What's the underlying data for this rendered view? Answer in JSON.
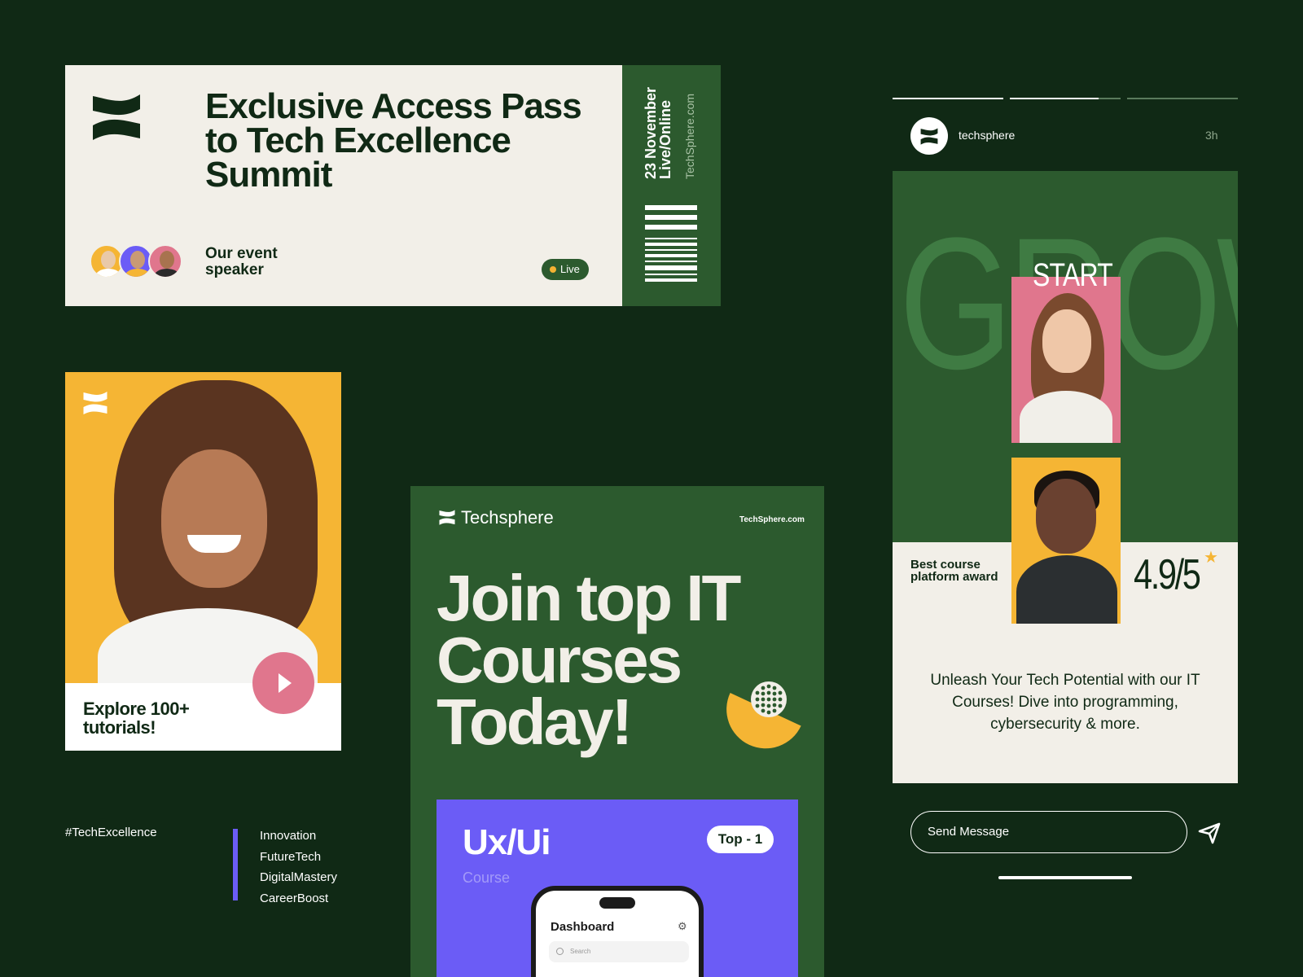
{
  "ticket": {
    "title": "Exclusive Access Pass to Tech Excellence Summit",
    "speaker_label": "Our event speaker",
    "live_label": "Live",
    "stub_date": "23 November",
    "stub_mode": "Live/Online",
    "stub_url": "TechSphere.com"
  },
  "tutorial": {
    "text": "Explore 100+ tutorials!"
  },
  "tags": {
    "hashtag": "#TechExcellence",
    "items": [
      "Innovation",
      "FutureTech",
      "DigitalMastery",
      "CareerBoost"
    ]
  },
  "poster": {
    "brand": "Techsphere",
    "url": "TechSphere.com",
    "title": "Join top IT Courses Today!",
    "course_title": "Ux/Ui",
    "course_subtitle": "Course",
    "course_badge": "Top - 1",
    "phone_title": "Dashboard",
    "phone_search_placeholder": "Search"
  },
  "story": {
    "username": "techsphere",
    "time": "3h",
    "progress": [
      1.0,
      0.8,
      0.0
    ],
    "bg_word": "GROW",
    "start_word": "START",
    "award": "Best course platform award",
    "rating": "4.9/5",
    "description": "Unleash Your Tech Potential with our IT Courses! Dive into programming, cybersecurity & more.",
    "message_placeholder": "Send Message"
  },
  "colors": {
    "background": "#102915",
    "green": "#2c5a2e",
    "cream": "#f2efe8",
    "yellow": "#f5b534",
    "pink": "#e0768d",
    "purple": "#6b5cf6"
  }
}
